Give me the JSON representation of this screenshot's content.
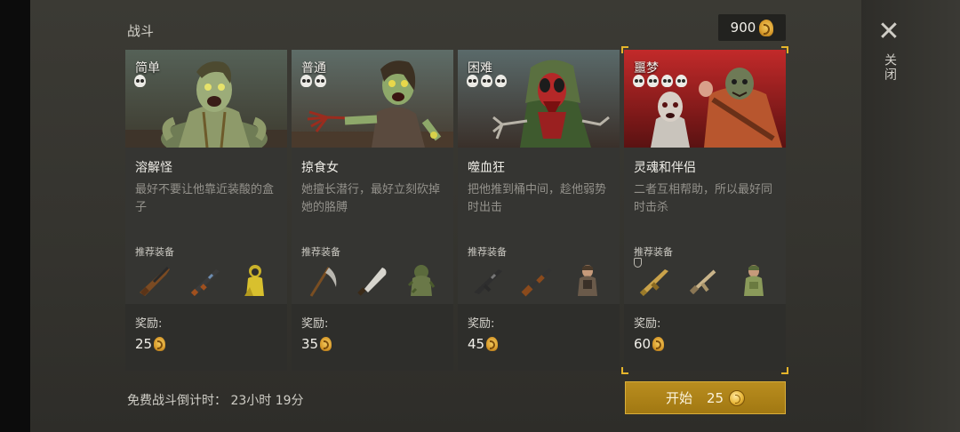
{
  "header": {
    "title": "战斗",
    "currency_amount": "900"
  },
  "close": {
    "icon": "close-icon",
    "label": "关闭"
  },
  "cards": [
    {
      "difficulty": "简单",
      "skulls": 1,
      "name": "溶解怪",
      "description": "最好不要让他靠近装酸的盒子",
      "equip_label": "推荐装备",
      "equipment": [
        "rifle-icon",
        "assault-rifle-icon",
        "hazmat-soldier-icon"
      ],
      "reward_label": "奖励:",
      "reward": "25",
      "selected": false,
      "red_header": false
    },
    {
      "difficulty": "普通",
      "skulls": 2,
      "name": "掠食女",
      "description": "她擅长潜行，最好立刻砍掉她的胳膊",
      "equip_label": "推荐装备",
      "equipment": [
        "scythe-icon",
        "machete-icon",
        "ghillie-soldier-icon"
      ],
      "reward_label": "奖励:",
      "reward": "35",
      "selected": false,
      "red_header": false
    },
    {
      "difficulty": "困难",
      "skulls": 3,
      "name": "噬血狂",
      "description": "把他推到桶中间，趁他弱势时出击",
      "equip_label": "推荐装备",
      "equipment": [
        "assault-rifle-icon",
        "shotgun-icon",
        "armored-soldier-icon"
      ],
      "reward_label": "奖励:",
      "reward": "45",
      "selected": false,
      "red_header": false
    },
    {
      "difficulty": "噩梦",
      "skulls": 4,
      "name": "灵魂和伴侣",
      "description": "二者互相帮助，所以最好同时击杀",
      "equip_label": "推荐装备",
      "equipment": [
        "gold-rifle-icon",
        "smg-icon",
        "camo-soldier-icon"
      ],
      "reward_label": "奖励:",
      "reward": "60",
      "selected": true,
      "red_header": true
    }
  ],
  "footer": {
    "countdown_label": "免费战斗倒计时：",
    "countdown_value": "23小时 19分",
    "start_label": "开始",
    "start_cost": "25"
  }
}
